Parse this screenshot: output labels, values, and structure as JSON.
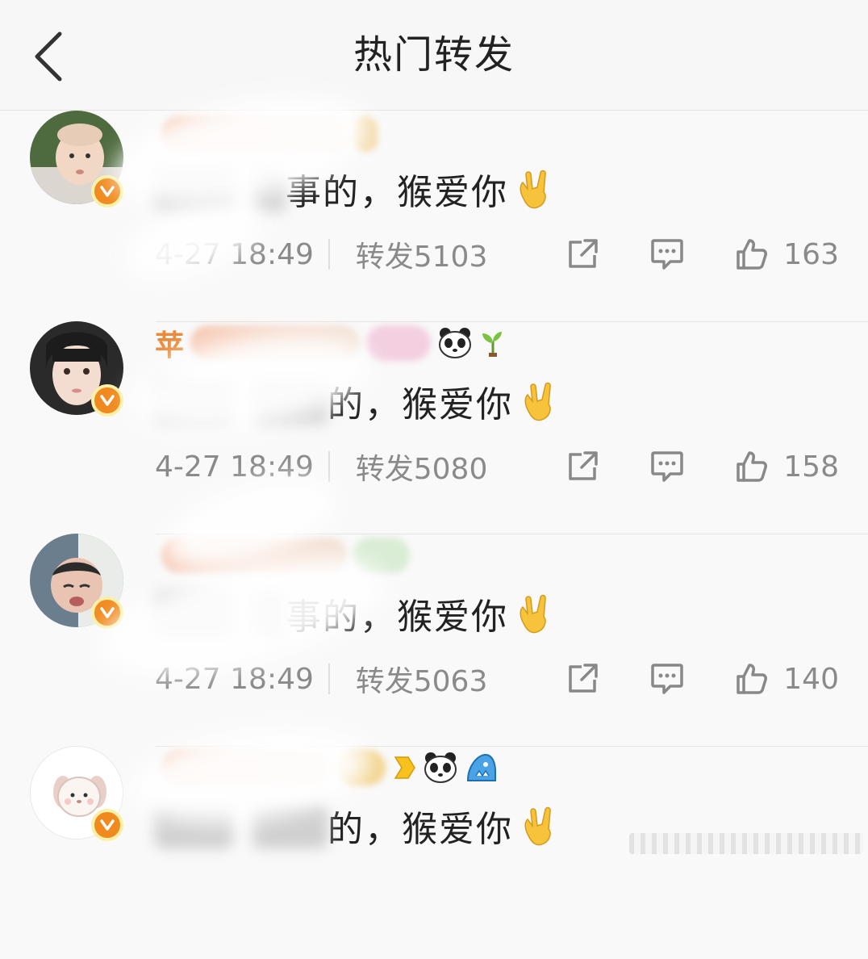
{
  "header": {
    "title": "热门转发",
    "back_icon": "chevron-left-icon"
  },
  "posts": [
    {
      "name_initial": "",
      "text_visible": "事的，猴爱你",
      "time": "4-27 18:49",
      "repost_label": "转发",
      "repost_count": "5103",
      "likes": "163",
      "avatar_theme": "baby-outdoor"
    },
    {
      "name_initial": "苹",
      "text_visible": "的，猴爱你",
      "time": "4-27 18:49",
      "repost_label": "转发",
      "repost_count": "5080",
      "likes": "158",
      "avatar_theme": "girl-portrait"
    },
    {
      "name_initial": "",
      "text_visible": "事的，猴爱你",
      "time": "4-27 18:49",
      "repost_label": "转发",
      "repost_count": "5063",
      "likes": "140",
      "avatar_theme": "baby-crying"
    },
    {
      "name_initial": "",
      "text_visible": "的，猴爱你",
      "time": "",
      "repost_label": "",
      "repost_count": "",
      "likes": "",
      "avatar_theme": "puppy-cartoon"
    }
  ],
  "colors": {
    "accent_orange": "#f08a1e",
    "badge_border": "#fbf0a6",
    "meta_gray": "#8a8a8a"
  }
}
